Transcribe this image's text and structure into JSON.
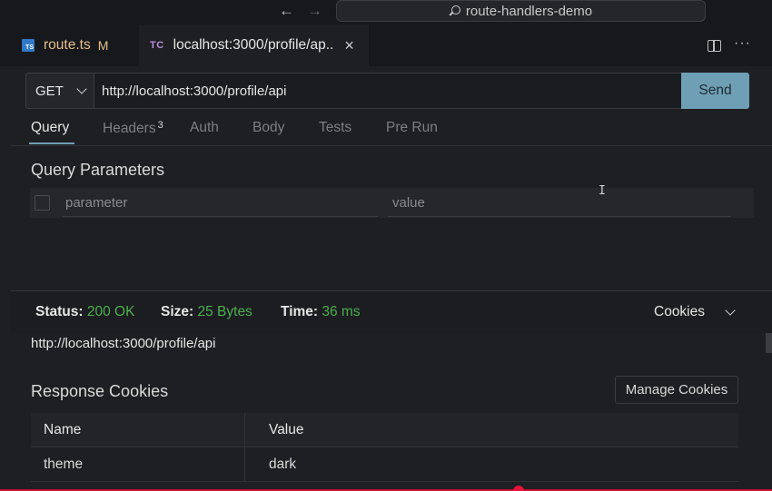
{
  "titlebar": {
    "search_text": "route-handlers-demo"
  },
  "tabs": [
    {
      "label": "route.ts",
      "icon": "typescript-file-icon",
      "badge": "M",
      "icon_text": "TS"
    },
    {
      "label": "localhost:3000/profile/ap..",
      "icon": "thunder-client-icon",
      "icon_text": "TC"
    }
  ],
  "request": {
    "method": "GET",
    "url": "http://localhost:3000/profile/api",
    "send_label": "Send",
    "tabs": [
      {
        "label": "Query",
        "count": ""
      },
      {
        "label": "Headers",
        "count": "3"
      },
      {
        "label": "Auth",
        "count": ""
      },
      {
        "label": "Body",
        "count": ""
      },
      {
        "label": "Tests",
        "count": ""
      },
      {
        "label": "Pre Run",
        "count": ""
      }
    ],
    "active_tab": "Query",
    "query": {
      "title": "Query Parameters",
      "param_placeholder": "parameter",
      "value_placeholder": "value"
    }
  },
  "response": {
    "status_label": "Status:",
    "status_value": "200 OK",
    "size_label": "Size:",
    "size_value": "25 Bytes",
    "time_label": "Time:",
    "time_value": "36 ms",
    "view_select": "Cookies",
    "url": "http://localhost:3000/profile/api",
    "cookies_title": "Response Cookies",
    "manage_label": "Manage Cookies",
    "columns": [
      "Name",
      "Value"
    ],
    "rows": [
      {
        "name": "theme",
        "value": "dark"
      }
    ]
  },
  "colors": {
    "accent": "#6e9fb5",
    "status_ok": "#4caf50",
    "modified": "#e2c08d"
  }
}
